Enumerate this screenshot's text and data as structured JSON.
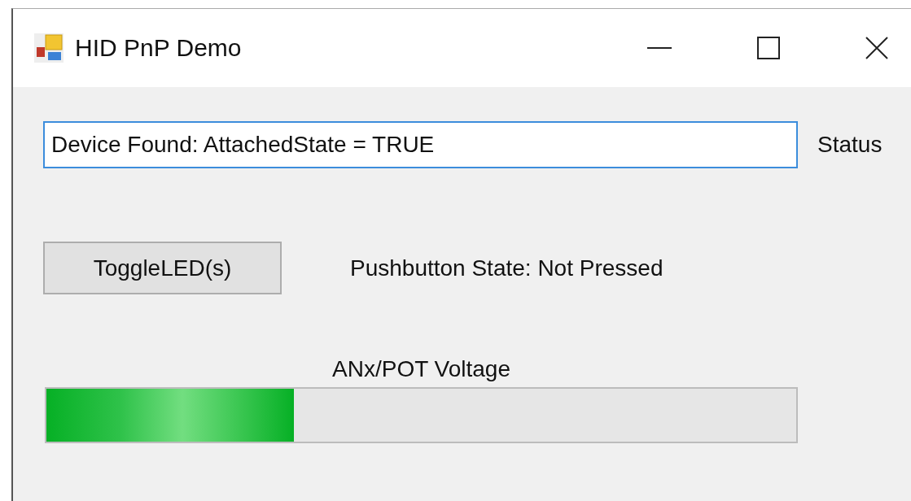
{
  "window": {
    "title": "HID PnP Demo"
  },
  "status_field": {
    "value": "Device Found: AttachedState = TRUE",
    "focused": true
  },
  "status_label": "Status",
  "toggle_button": {
    "label": "ToggleLED(s)"
  },
  "pushbutton_state": "Pushbutton State: Not Pressed",
  "voltage": {
    "label": "ANx/POT Voltage",
    "level": 0.33
  }
}
